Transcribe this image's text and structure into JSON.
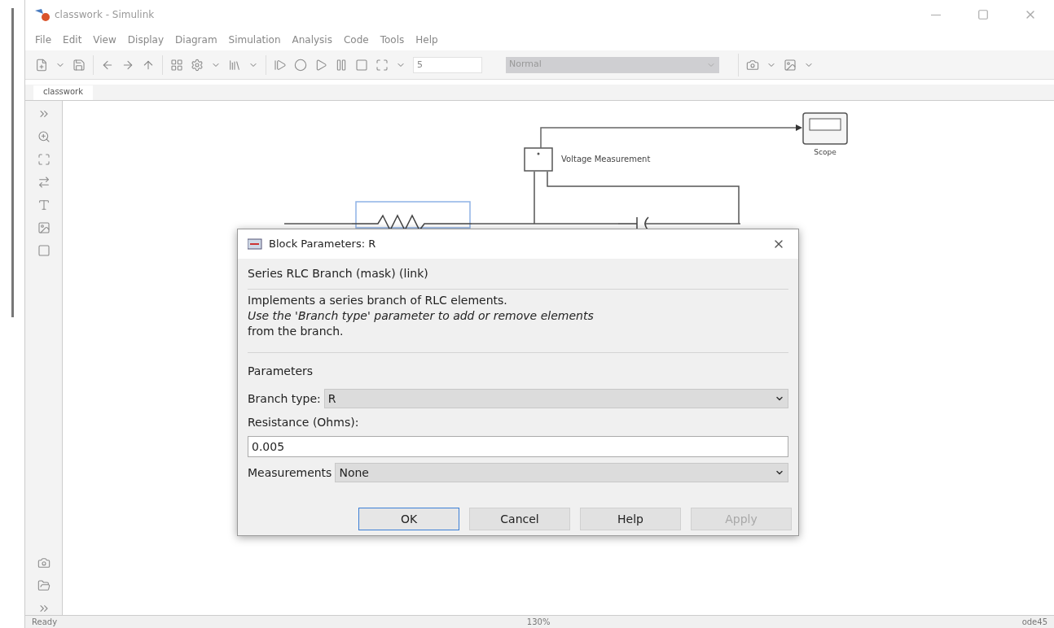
{
  "window": {
    "title": "classwork - Simulink"
  },
  "menu": [
    "File",
    "Edit",
    "View",
    "Display",
    "Diagram",
    "Simulation",
    "Analysis",
    "Code",
    "Tools",
    "Help"
  ],
  "toolbar": {
    "stop_time": "5",
    "mode": "Normal"
  },
  "tabs": [
    {
      "label": "classwork",
      "selected": true
    }
  ],
  "diagram": {
    "blocks": [
      {
        "kind": "voltage",
        "label": "Voltage Measurement"
      },
      {
        "kind": "scope",
        "label": "Scope"
      },
      {
        "kind": "resistor",
        "selected": true
      },
      {
        "kind": "capacitor"
      }
    ]
  },
  "dialog": {
    "title": "Block Parameters: R",
    "heading": "Series RLC Branch (mask) (link)",
    "description": [
      "Implements a series branch of RLC elements.",
      "*Use the 'Branch type' parameter to add or remove elements*",
      "from the branch."
    ],
    "section": "Parameters",
    "fields": [
      {
        "kind": "dropdown",
        "label": "Branch type:",
        "value": "R"
      },
      {
        "kind": "text",
        "label": "Resistance (Ohms):",
        "value": "0.005"
      },
      {
        "kind": "dropdown",
        "label": "Measurements",
        "value": "None"
      }
    ],
    "buttons": [
      {
        "label": "OK",
        "focused": true,
        "disabled": false
      },
      {
        "label": "Cancel",
        "focused": false,
        "disabled": false
      },
      {
        "label": "Help",
        "focused": false,
        "disabled": false
      },
      {
        "label": "Apply",
        "focused": false,
        "disabled": true
      }
    ]
  },
  "status_bar": [
    "Ready",
    "130%",
    "ode45"
  ]
}
